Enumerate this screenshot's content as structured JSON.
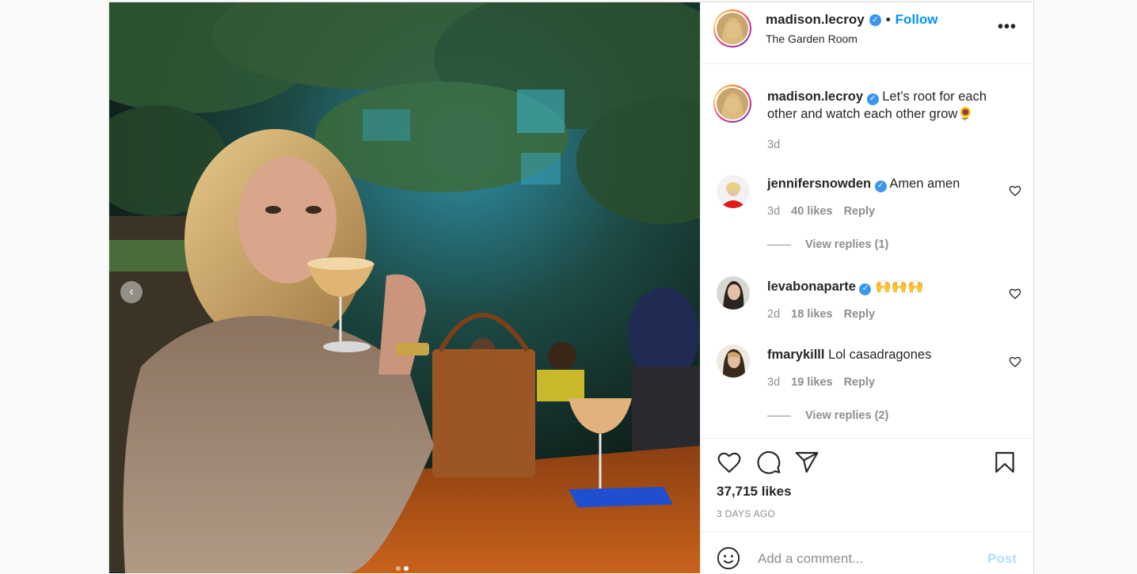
{
  "post": {
    "username": "madison.lecroy",
    "follow_label": "Follow",
    "separator": "•",
    "location": "The Garden Room",
    "more_icon": "more-horizontal-icon",
    "verified_icon": "verified-badge-icon"
  },
  "caption": {
    "username": "madison.lecroy",
    "text": "Let’s root for each other and watch each other grow🌻",
    "time": "3d"
  },
  "comments": [
    {
      "username": "jennifersnowden",
      "verified": true,
      "text": "Amen amen",
      "time": "3d",
      "likes": "40 likes",
      "reply_label": "Reply",
      "view_replies": "View replies (1)"
    },
    {
      "username": "levabonaparte",
      "verified": true,
      "text": "🙌🙌🙌",
      "time": "2d",
      "likes": "18 likes",
      "reply_label": "Reply"
    },
    {
      "username": "fmarykilll",
      "verified": false,
      "text": "Lol casadragones",
      "time": "3d",
      "likes": "19 likes",
      "reply_label": "Reply",
      "view_replies": "View replies (2)"
    }
  ],
  "actions": {
    "likes": "37,715 likes",
    "posted_ago": "3 DAYS AGO",
    "icons": [
      "heart-icon",
      "comment-icon",
      "share-icon",
      "bookmark-icon"
    ]
  },
  "add_comment": {
    "placeholder": "Add a comment...",
    "post_label": "Post"
  },
  "carousel": {
    "slide_count": 2,
    "active_index": 1
  },
  "colors": {
    "link": "#0095f6",
    "verified": "#3897f0",
    "muted": "#8e8e8e",
    "post_disabled": "#b2dffc"
  }
}
